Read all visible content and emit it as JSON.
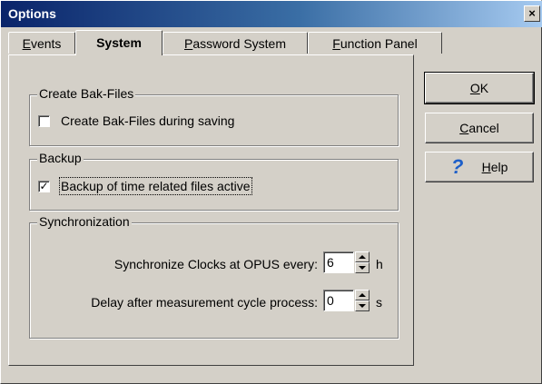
{
  "window": {
    "title": "Options",
    "close_glyph": "×"
  },
  "tabs": [
    {
      "pre": "",
      "mn": "E",
      "post": "vents"
    },
    {
      "pre": "",
      "mn": "",
      "post": "System"
    },
    {
      "pre": "",
      "mn": "P",
      "post": "assword System"
    },
    {
      "pre": "",
      "mn": "F",
      "post": "unction Panel"
    }
  ],
  "groups": {
    "bak": {
      "title": "Create Bak-Files",
      "checkbox_label": "Create Bak-Files during saving",
      "checked": false
    },
    "backup": {
      "title": "Backup",
      "checkbox_label": "Backup of time related files active",
      "checked": true,
      "check_glyph": "✓"
    },
    "sync": {
      "title": "Synchronization",
      "clocks_label": "Synchronize Clocks at OPUS every:",
      "clocks_value": "6",
      "clocks_unit": "h",
      "delay_label": "Delay after measurement cycle process:",
      "delay_value": "0",
      "delay_unit": "s"
    }
  },
  "buttons": {
    "ok": {
      "mn": "O",
      "post": "K"
    },
    "cancel": {
      "mn": "C",
      "post": "ancel"
    },
    "help": {
      "icon": "?",
      "mn": "H",
      "post": "elp"
    }
  }
}
